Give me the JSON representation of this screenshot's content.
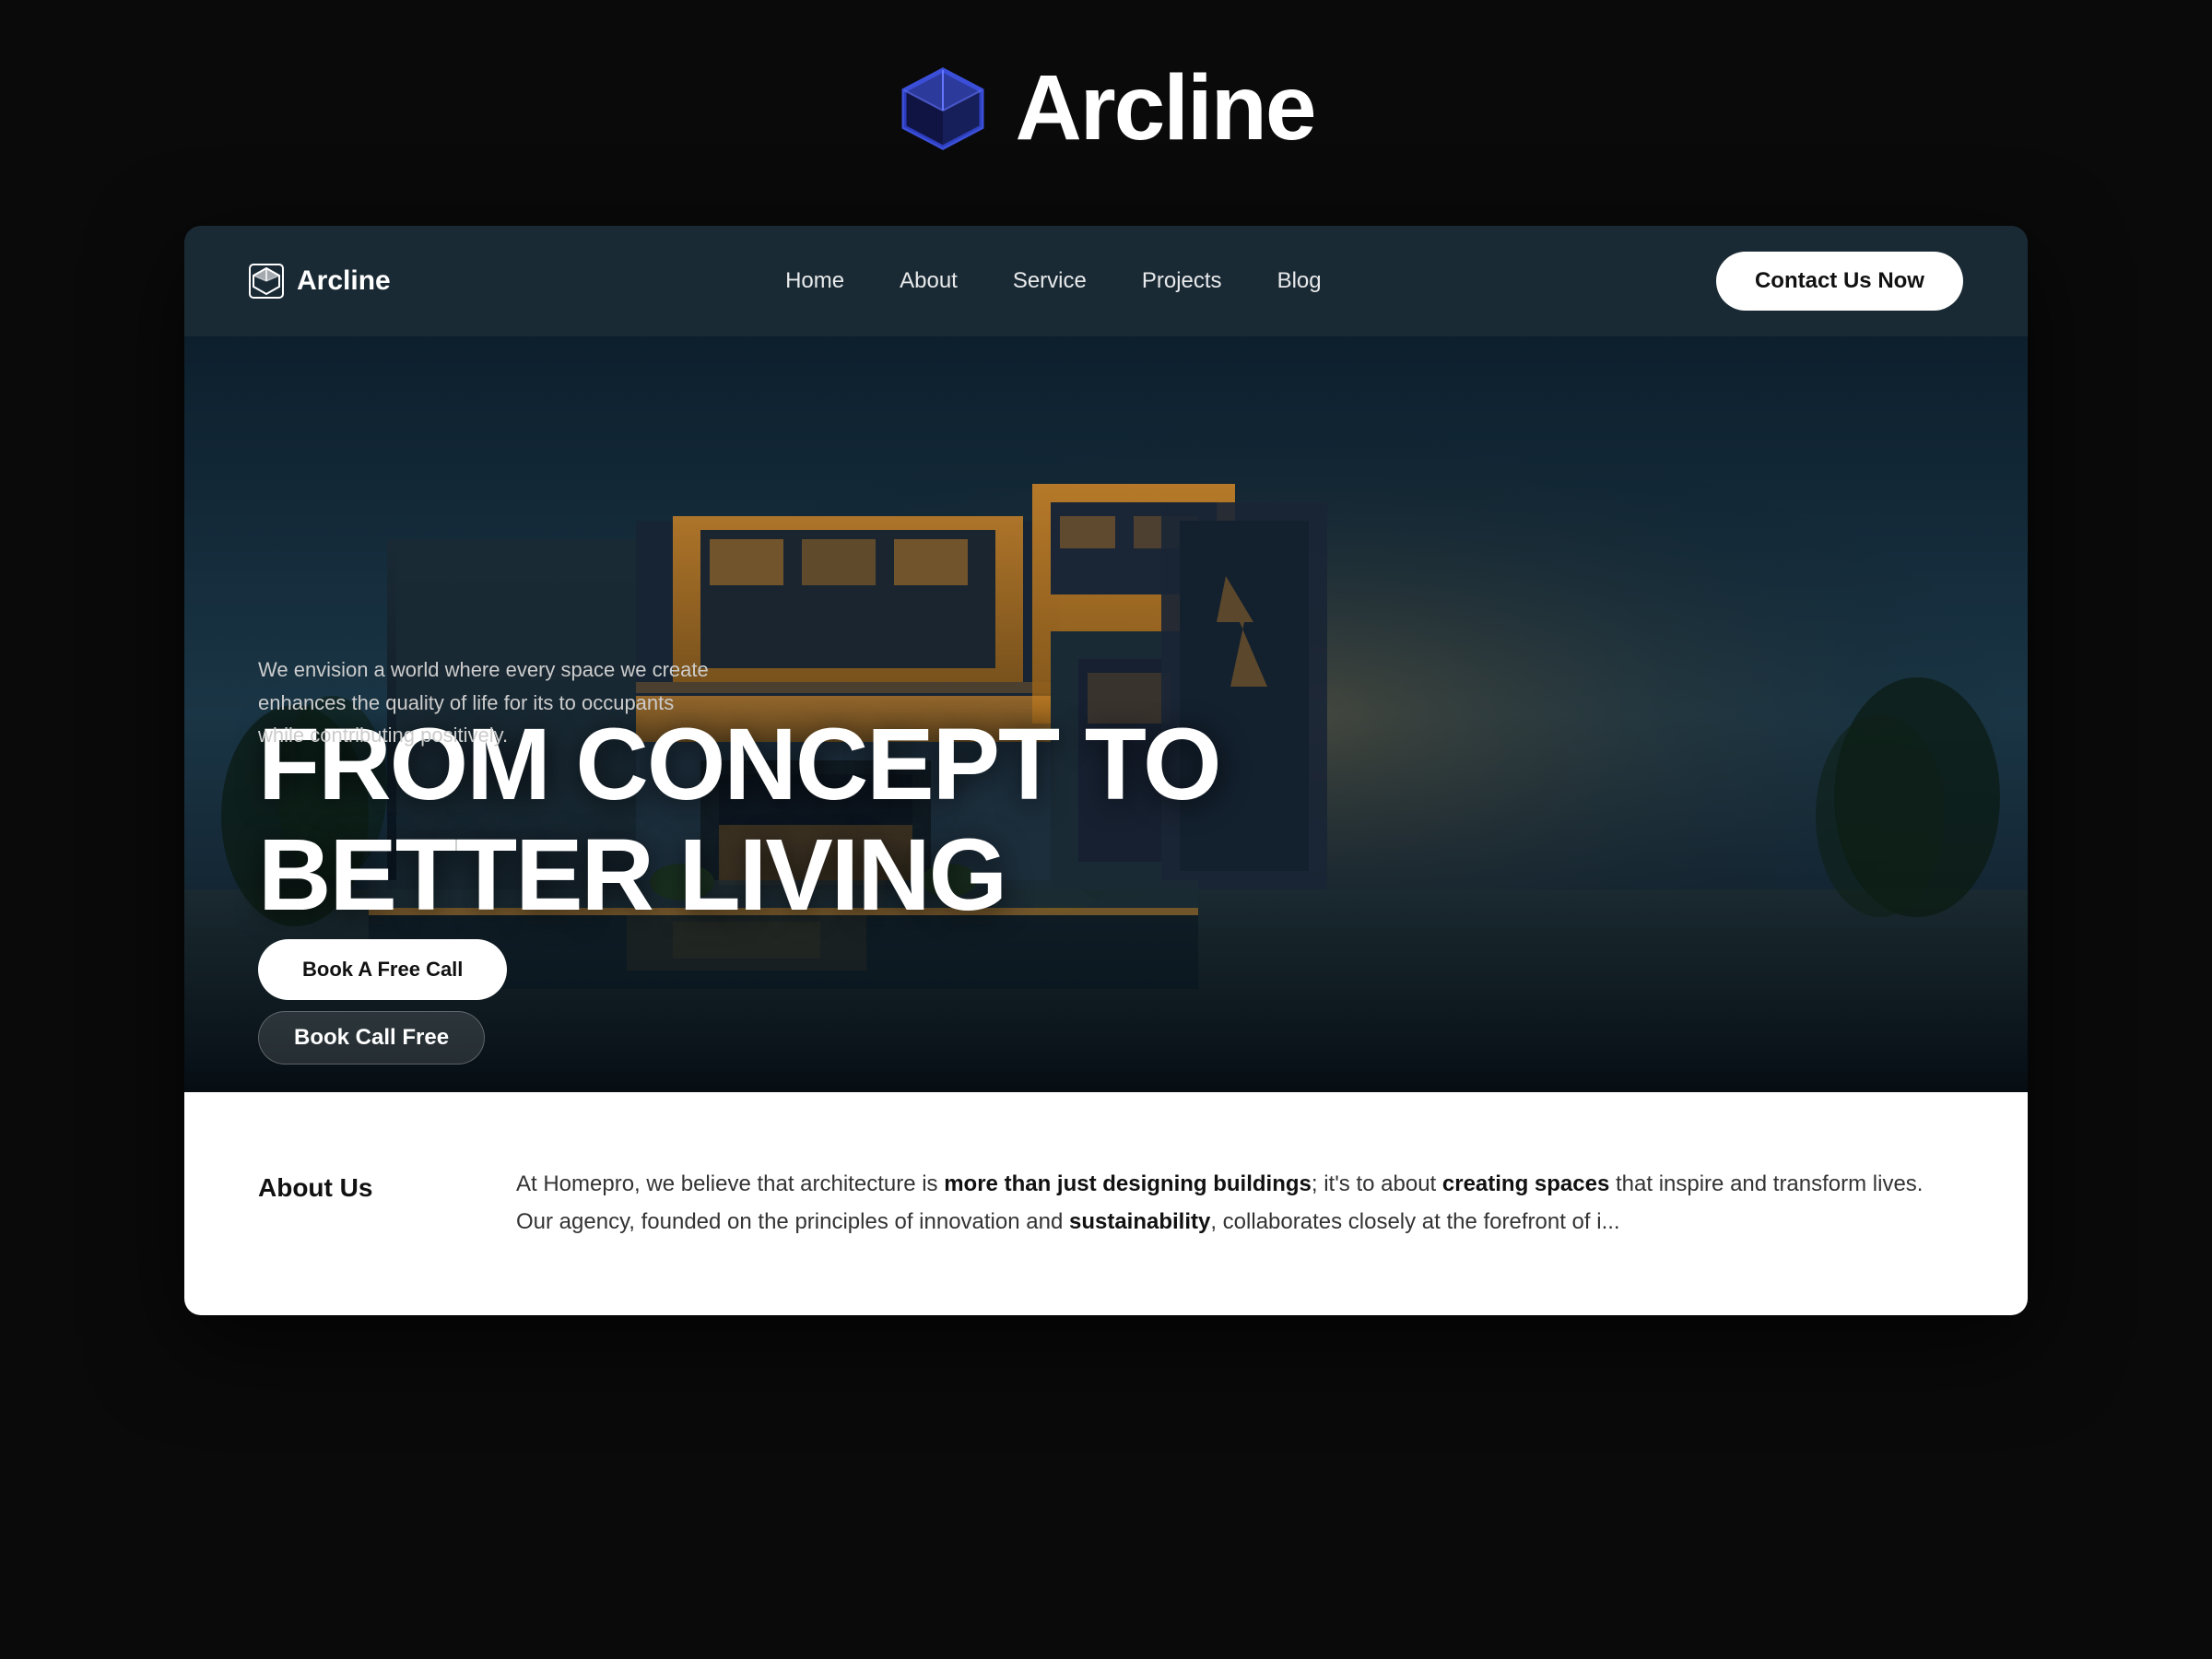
{
  "brand": {
    "name": "Arcline",
    "icon_label": "box-3d-icon"
  },
  "navbar": {
    "brand_name": "Arcline",
    "brand_icon_label": "box-icon",
    "links": [
      {
        "label": "Home",
        "id": "home"
      },
      {
        "label": "About",
        "id": "about"
      },
      {
        "label": "Service",
        "id": "service"
      },
      {
        "label": "Projects",
        "id": "projects"
      },
      {
        "label": "Blog",
        "id": "blog"
      }
    ],
    "cta_label": "Contact Us Now"
  },
  "hero": {
    "headline_line1": "FROM CONCEPT TO",
    "headline_line2": "BETTER LIVING",
    "subtext": "We envision a world where every space we create enhances the quality of life for its to occupants while contributing positively.",
    "cta_label": "Book A Free Call"
  },
  "about": {
    "section_label": "About Us",
    "text_part1": "At Homepro, we believe that architecture is ",
    "text_bold1": "more than just designing buildings",
    "text_part2": "; it's to about ",
    "text_bold2": "creating spaces",
    "text_part3": " that inspire and transform lives. Our agency, founded on the principles of innovation and ",
    "text_bold3": "sustainability",
    "text_part4": ", collaborates closely at the forefront of i..."
  },
  "floating": {
    "badge_label": "Book Call Free"
  },
  "colors": {
    "background": "#0a0a0a",
    "navbar_bg": "#1a2a35",
    "hero_bg_from": "#0d1f2d",
    "brand_blue": "#3b4fd8",
    "accent_warm": "#c88228",
    "white": "#ffffff"
  }
}
